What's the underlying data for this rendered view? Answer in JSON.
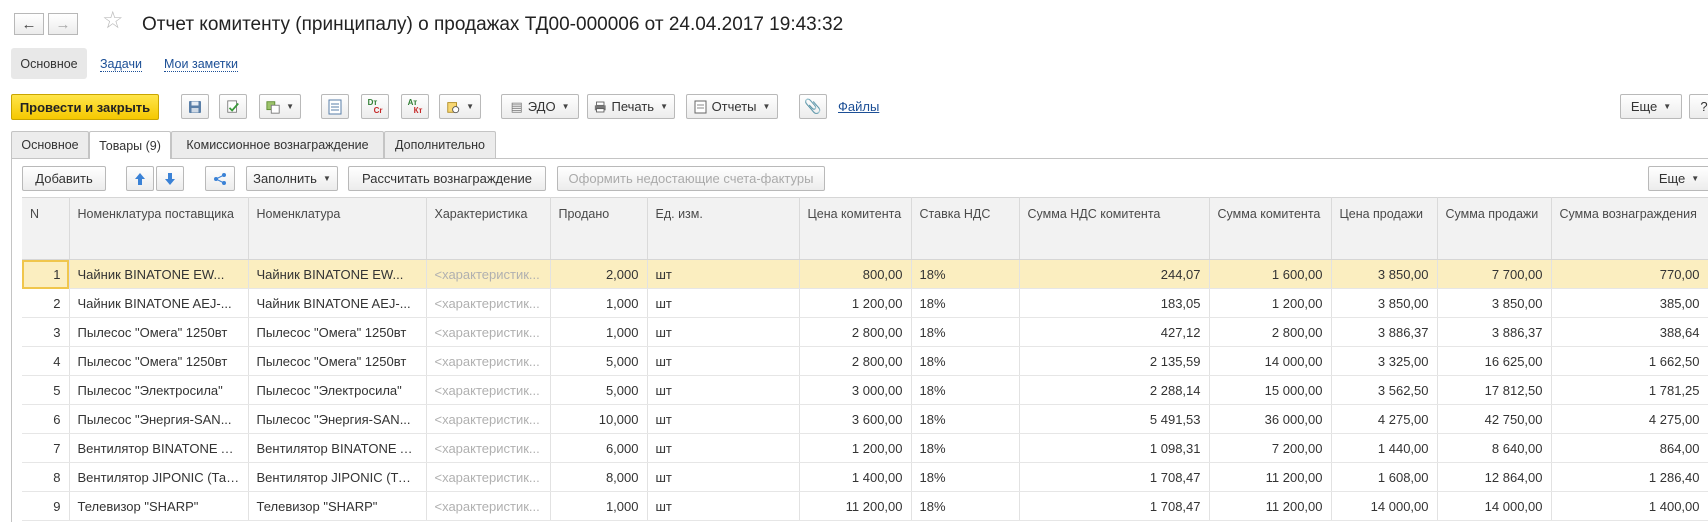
{
  "window": {
    "title": "Отчет комитенту (принципалу) о продажах ТД00-000006 от 24.04.2017 19:43:32"
  },
  "sections": [
    "Основное",
    "Задачи",
    "Мои заметки"
  ],
  "toolbar": {
    "post_close": "Провести и закрыть",
    "edo": "ЭДО",
    "print": "Печать",
    "reports": "Отчеты",
    "files": "Файлы",
    "more": "Еще",
    "help": "?",
    "dt_kt_1": "Dт",
    "dt_kt_2": "Cr",
    "dt_kt_3": "Ат",
    "dt_kt_4": "Кт"
  },
  "form_tabs": [
    "Основное",
    "Товары (9)",
    "Комиссионное вознаграждение",
    "Дополнительно"
  ],
  "table_toolbar": {
    "add": "Добавить",
    "fill": "Заполнить",
    "calc": "Рассчитать вознаграждение",
    "invoice": "Оформить недостающие счета-фактуры",
    "more": "Еще"
  },
  "columns": [
    "N",
    "Номенклатура поставщика",
    "Номенклатура",
    "Характеристика",
    "Продано",
    "Ед. изм.",
    "Цена комитента",
    "Ставка НДС",
    "Сумма НДС комитента",
    "Сумма комитента",
    "Цена продажи",
    "Сумма продажи",
    "Сумма вознаграждения"
  ],
  "rows": [
    [
      "1",
      "Чайник BINATONE  EW...",
      "Чайник BINATONE  EW...",
      "<характеристик...",
      "2,000",
      "шт",
      "800,00",
      "18%",
      "244,07",
      "1 600,00",
      "3 850,00",
      "7 700,00",
      "770,00"
    ],
    [
      "2",
      "Чайник BINATONE  AEJ-...",
      "Чайник BINATONE  AEJ-...",
      "<характеристик...",
      "1,000",
      "шт",
      "1 200,00",
      "18%",
      "183,05",
      "1 200,00",
      "3 850,00",
      "3 850,00",
      "385,00"
    ],
    [
      "3",
      "Пылесос \"Омега\" 1250вт",
      "Пылесос \"Омега\" 1250вт",
      "<характеристик...",
      "1,000",
      "шт",
      "2 800,00",
      "18%",
      "427,12",
      "2 800,00",
      "3 886,37",
      "3 886,37",
      "388,64"
    ],
    [
      "4",
      "Пылесос \"Омега\" 1250вт",
      "Пылесос \"Омега\" 1250вт",
      "<характеристик...",
      "5,000",
      "шт",
      "2 800,00",
      "18%",
      "2 135,59",
      "14 000,00",
      "3 325,00",
      "16 625,00",
      "1 662,50"
    ],
    [
      "5",
      "Пылесос \"Электросила\"",
      "Пылесос \"Электросила\"",
      "<характеристик...",
      "5,000",
      "шт",
      "3 000,00",
      "18%",
      "2 288,14",
      "15 000,00",
      "3 562,50",
      "17 812,50",
      "1 781,25"
    ],
    [
      "6",
      "Пылесос \"Энергия-SAN...",
      "Пылесос \"Энергия-SAN...",
      "<характеристик...",
      "10,000",
      "шт",
      "3 600,00",
      "18%",
      "5 491,53",
      "36 000,00",
      "4 275,00",
      "42 750,00",
      "4 275,00"
    ],
    [
      "7",
      "Вентилятор BINATONE A...",
      "Вентилятор BINATONE A...",
      "<характеристик...",
      "6,000",
      "шт",
      "1 200,00",
      "18%",
      "1 098,31",
      "7 200,00",
      "1 440,00",
      "8 640,00",
      "864,00"
    ],
    [
      "8",
      "Вентилятор JIPONIC (Тай...",
      "Вентилятор JIPONIC (Тай...",
      "<характеристик...",
      "8,000",
      "шт",
      "1 400,00",
      "18%",
      "1 708,47",
      "11 200,00",
      "1 608,00",
      "12 864,00",
      "1 286,40"
    ],
    [
      "9",
      "Телевизор \"SHARP\"",
      "Телевизор \"SHARP\"",
      "<характеристик...",
      "1,000",
      "шт",
      "11 200,00",
      "18%",
      "1 708,47",
      "11 200,00",
      "14 000,00",
      "14 000,00",
      "1 400,00"
    ]
  ]
}
